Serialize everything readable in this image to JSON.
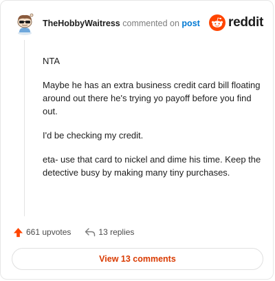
{
  "header": {
    "username": "TheHobbyWaitress",
    "action_text": "commented on",
    "post_link": "post",
    "brand": "reddit"
  },
  "comment": {
    "paragraphs": [
      "NTA",
      "Maybe he has an extra business credit card bill floating around out there he's trying yo payoff before you find out.",
      "I'd be checking my credit.",
      "eta- use that card to nickel and dime his time. Keep the detective busy by making many tiny purchases."
    ]
  },
  "actions": {
    "upvotes": "661 upvotes",
    "replies": "13 replies"
  },
  "footer": {
    "view_comments": "View 13 comments"
  },
  "icons": {
    "upvote": "upvote-arrow-icon",
    "reply": "reply-arrow-icon",
    "avatar": "snoo-avatar",
    "logo": "reddit-snoo-logo"
  },
  "colors": {
    "brand_orange": "#ff4500",
    "link_blue": "#0079d3",
    "button_text": "#d93a00"
  }
}
